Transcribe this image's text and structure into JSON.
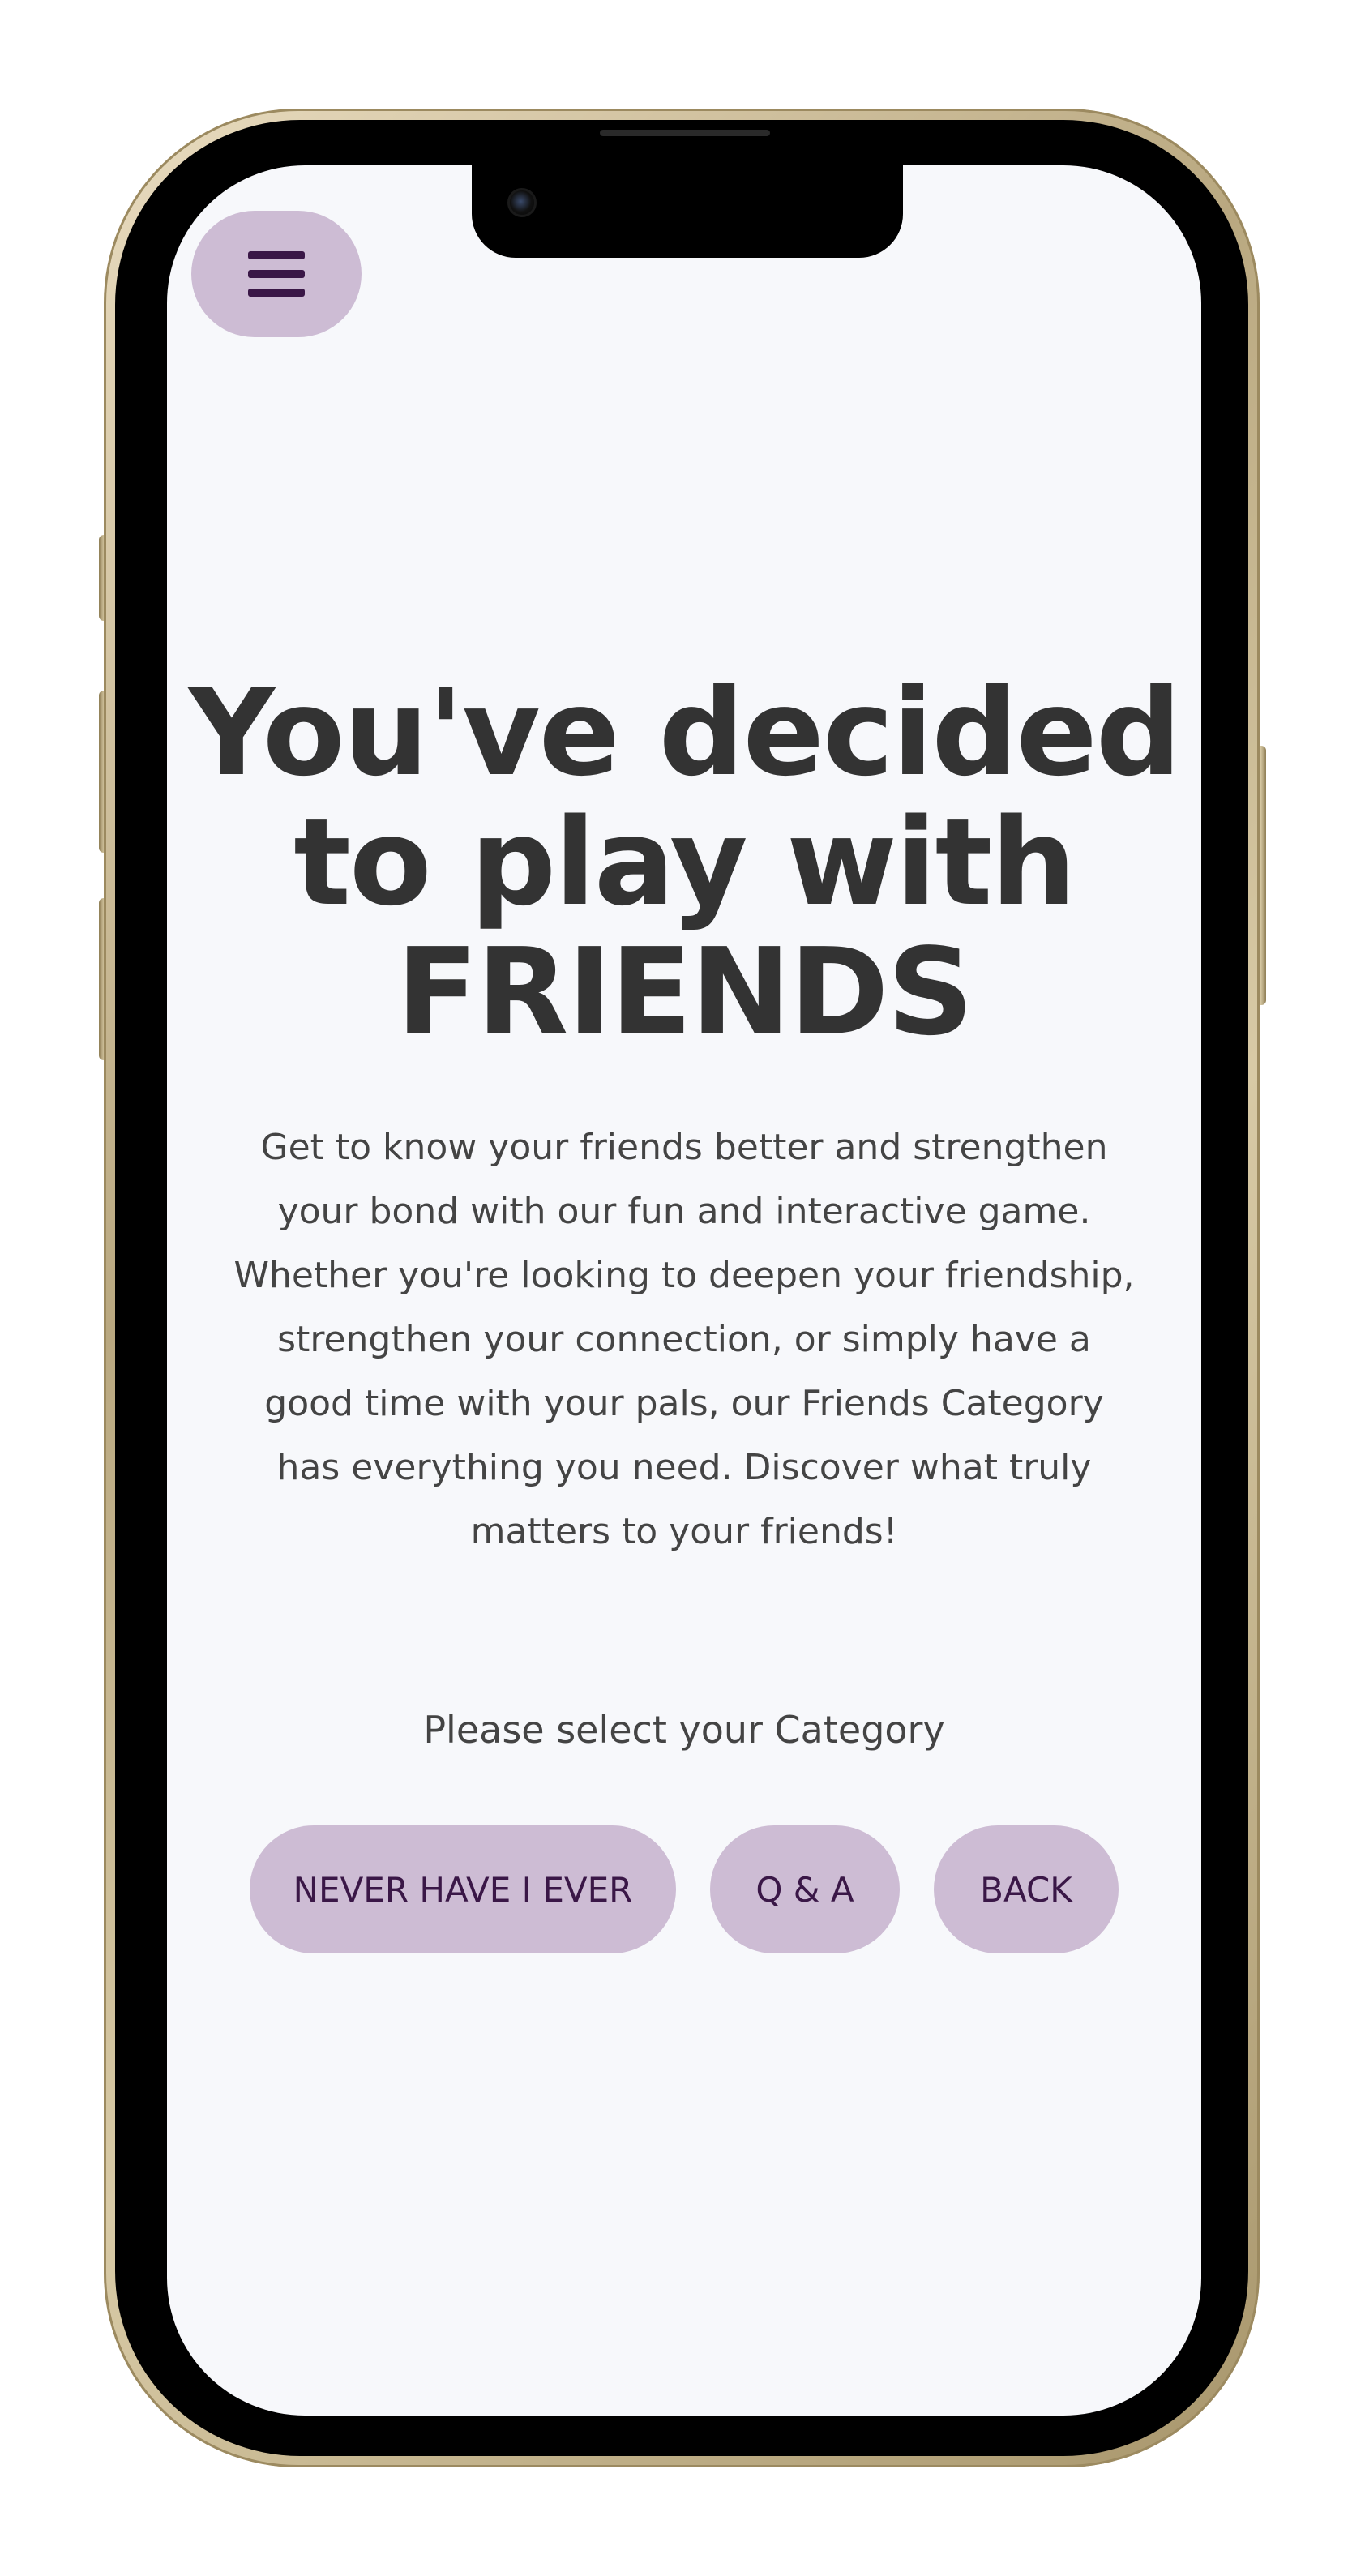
{
  "header": {
    "menu_icon": "hamburger-menu-icon"
  },
  "main": {
    "title_line1": "You've decided",
    "title_line2": "to play with",
    "title_line3": "FRIENDS",
    "description_lines": [
      "Get to know your friends better and strengthen",
      "your bond with our fun and interactive game.",
      "Whether you're looking to deepen your friendship,",
      "strengthen your connection, or simply have a",
      "good time with your pals, our Friends Category",
      "has everything you need. Discover what truly",
      "matters to your friends!"
    ],
    "prompt": "Please select your Category",
    "buttons": {
      "never": "NEVER HAVE I EVER",
      "qa": "Q & A",
      "back": "BACK"
    }
  },
  "colors": {
    "accent": "#cdbcd4",
    "accent_text": "#3a1747",
    "background": "#f7f8fb",
    "heading": "#333333",
    "body_text": "#444444"
  }
}
